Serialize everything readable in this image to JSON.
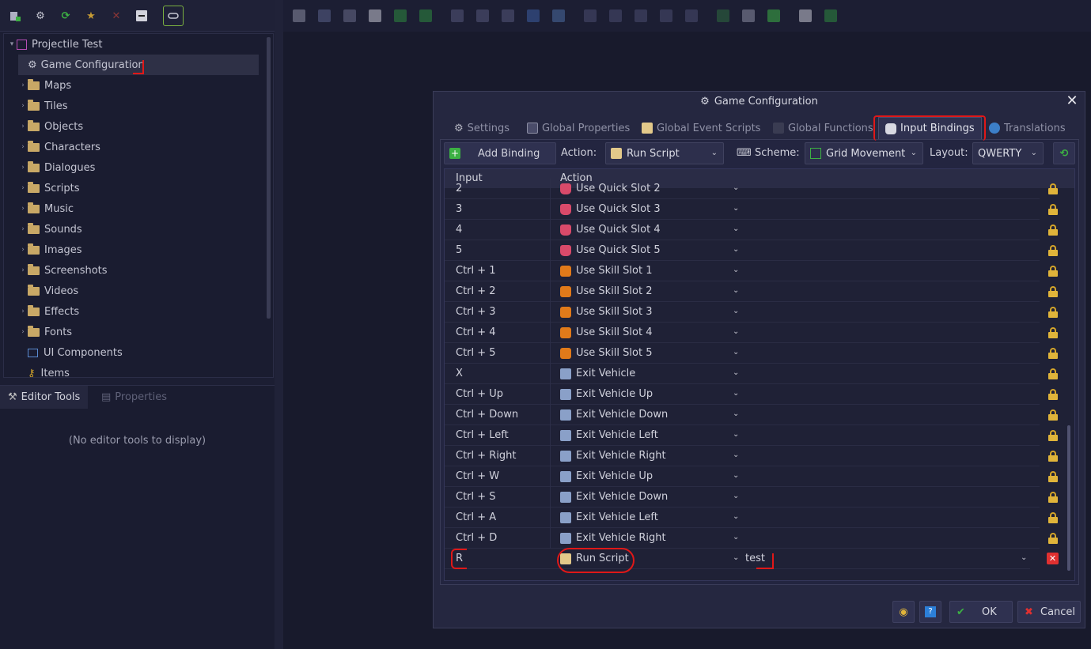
{
  "tree": {
    "project": "Projectile Test",
    "items": [
      {
        "label": "Game Configuration",
        "kind": "gear"
      },
      {
        "label": "Maps",
        "kind": "folder"
      },
      {
        "label": "Tiles",
        "kind": "folder"
      },
      {
        "label": "Objects",
        "kind": "folder"
      },
      {
        "label": "Characters",
        "kind": "folder"
      },
      {
        "label": "Dialogues",
        "kind": "folder"
      },
      {
        "label": "Scripts",
        "kind": "folder"
      },
      {
        "label": "Music",
        "kind": "folder"
      },
      {
        "label": "Sounds",
        "kind": "folder"
      },
      {
        "label": "Images",
        "kind": "folder"
      },
      {
        "label": "Screenshots",
        "kind": "folder"
      },
      {
        "label": "Videos",
        "kind": "folder"
      },
      {
        "label": "Effects",
        "kind": "folder"
      },
      {
        "label": "Fonts",
        "kind": "folder"
      },
      {
        "label": "UI Components",
        "kind": "ui"
      },
      {
        "label": "Items",
        "kind": "key"
      }
    ]
  },
  "bottom_tabs": {
    "editor_tools": "Editor Tools",
    "properties": "Properties"
  },
  "no_tools_text": "(No editor tools to display)",
  "dialog": {
    "title": "Game Configuration",
    "close_glyph": "✕",
    "tabs": [
      "Settings",
      "Global Properties",
      "Global Event Scripts",
      "Global Functions",
      "Input Bindings",
      "Translations"
    ],
    "active_tab": "Input Bindings",
    "toolbar": {
      "add_binding": "Add Binding",
      "action_label": "Action:",
      "action_value": "Run Script",
      "scheme_label": "Scheme:",
      "scheme_value": "Grid Movement",
      "layout_label": "Layout:",
      "layout_value": "QWERTY"
    },
    "columns": {
      "input": "Input",
      "action": "Action"
    },
    "rows": [
      {
        "input": "2",
        "action": "Use Quick Slot 2",
        "icon": "potion"
      },
      {
        "input": "3",
        "action": "Use Quick Slot 3",
        "icon": "potion"
      },
      {
        "input": "4",
        "action": "Use Quick Slot 4",
        "icon": "potion"
      },
      {
        "input": "5",
        "action": "Use Quick Slot 5",
        "icon": "potion"
      },
      {
        "input": "Ctrl + 1",
        "action": "Use Skill Slot 1",
        "icon": "skill"
      },
      {
        "input": "Ctrl + 2",
        "action": "Use Skill Slot 2",
        "icon": "skill"
      },
      {
        "input": "Ctrl + 3",
        "action": "Use Skill Slot 3",
        "icon": "skill"
      },
      {
        "input": "Ctrl + 4",
        "action": "Use Skill Slot 4",
        "icon": "skill"
      },
      {
        "input": "Ctrl + 5",
        "action": "Use Skill Slot 5",
        "icon": "skill"
      },
      {
        "input": "X",
        "action": "Exit Vehicle",
        "icon": "vehicle"
      },
      {
        "input": "Ctrl + Up",
        "action": "Exit Vehicle Up",
        "icon": "vehicle"
      },
      {
        "input": "Ctrl + Down",
        "action": "Exit Vehicle Down",
        "icon": "vehicle"
      },
      {
        "input": "Ctrl + Left",
        "action": "Exit Vehicle Left",
        "icon": "vehicle"
      },
      {
        "input": "Ctrl + Right",
        "action": "Exit Vehicle Right",
        "icon": "vehicle"
      },
      {
        "input": "Ctrl + W",
        "action": "Exit Vehicle Up",
        "icon": "vehicle"
      },
      {
        "input": "Ctrl + S",
        "action": "Exit Vehicle Down",
        "icon": "vehicle"
      },
      {
        "input": "Ctrl + A",
        "action": "Exit Vehicle Left",
        "icon": "vehicle"
      },
      {
        "input": "Ctrl + D",
        "action": "Exit Vehicle Right",
        "icon": "vehicle"
      }
    ],
    "custom_row": {
      "input": "R",
      "action": "Run Script",
      "script": "test"
    },
    "footer": {
      "ok": "OK",
      "cancel": "Cancel"
    }
  },
  "colors": {
    "accent_green": "#3cb043",
    "lock_gold": "#e0b43a",
    "danger_red": "#e03030",
    "annotation_red": "#e01818"
  }
}
